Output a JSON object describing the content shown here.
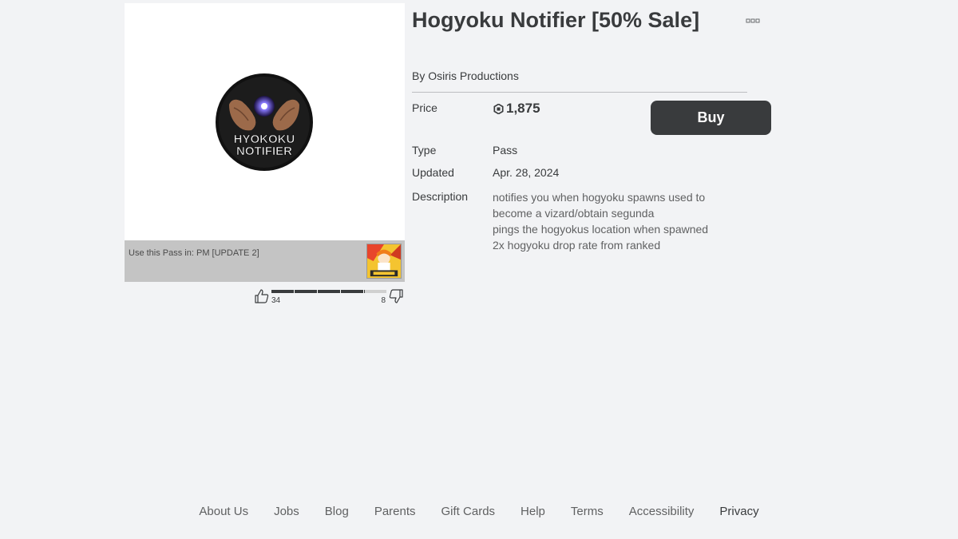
{
  "item": {
    "title": "Hogyoku Notifier [50% Sale]",
    "creator_prefix": "By",
    "creator_name": "Osiris Productions",
    "thumbnail_icon": "hyokoku-notifier-badge",
    "thumbnail_text_line1": "HYOKOKU",
    "thumbnail_text_line2": "NOTIFIER"
  },
  "place": {
    "label": "Use this Pass in: PM [UPDATE 2]"
  },
  "votes": {
    "up": "34",
    "down": "8",
    "up_fraction": 0.81
  },
  "details": {
    "price_label": "Price",
    "price_value": "1,875",
    "type_label": "Type",
    "type_value": "Pass",
    "updated_label": "Updated",
    "updated_value": "Apr. 28, 2024",
    "description_label": "Description",
    "description_lines": [
      "notifies you when hogyoku spawns used to",
      "become a vizard/obtain segunda",
      "pings the hogyokus location when spawned",
      "2x hogyoku drop rate from ranked"
    ]
  },
  "buy_button": {
    "label": "Buy"
  },
  "footer": {
    "links": [
      "About Us",
      "Jobs",
      "Blog",
      "Parents",
      "Gift Cards",
      "Help",
      "Terms",
      "Accessibility",
      "Privacy"
    ]
  },
  "colors": {
    "background": "#f2f3f5",
    "text": "#393b3d",
    "button": "#393b3d",
    "muted": "#606162"
  }
}
